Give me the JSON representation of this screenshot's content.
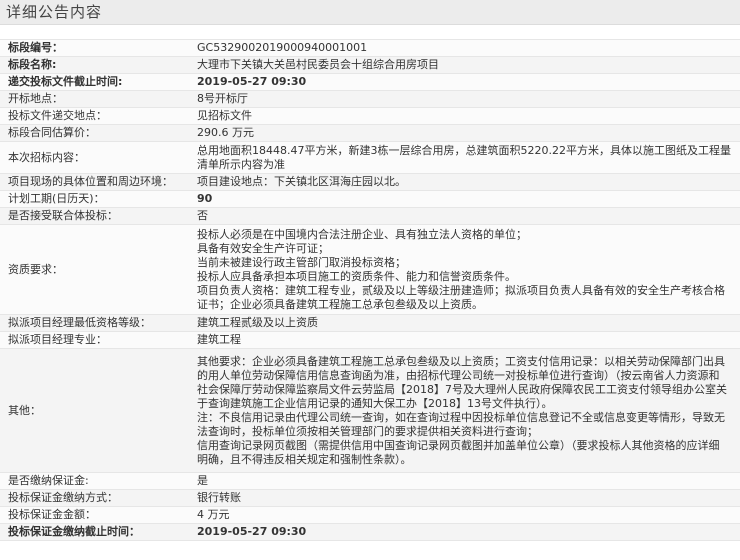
{
  "title": "详细公告内容",
  "rows": [
    {
      "label": "标段编号：",
      "value": "GC5329002019000940001001"
    },
    {
      "label": "标段名称:",
      "value": "大理市下关镇大关邑村民委员会十组综合用房项目"
    },
    {
      "label": "递交投标文件截止时间:",
      "value": "2019-05-27 09:30"
    },
    {
      "label": "开标地点：",
      "value": "8号开标厅"
    },
    {
      "label": "投标文件递交地点：",
      "value": "见招标文件"
    },
    {
      "label": "标段合同估算价：",
      "value": "290.6 万元"
    },
    {
      "label": "本次招标内容：",
      "lines": [
        "总用地面积18448.47平方米，新建3栋一层综合用房，总建筑面积5220.22平方米，具体以施工图纸及工程量",
        "清单所示内容为准"
      ]
    },
    {
      "label": "项目现场的具体位置和周边环境：",
      "value": "项目建设地点：下关镇北区洱海庄园以北。"
    },
    {
      "label": "计划工期(日历天)：",
      "value": "90"
    },
    {
      "label": "是否接受联合体投标：",
      "value": "否"
    },
    {
      "label": "资质要求：",
      "lines": [
        "投标人必须是在中国境内合法注册企业、具有独立法人资格的单位；",
        "具备有效安全生产许可证；",
        "当前未被建设行政主管部门取消投标资格；",
        "投标人应具备承担本项目施工的资质条件、能力和信誉资质条件。",
        "项目负责人资格：建筑工程专业，贰级及以上等级注册建造师；拟派项目负责人具备有效的安全生产考核合格",
        "证书；企业必须具备建筑工程施工总承包叁级及以上资质。"
      ]
    },
    {
      "label": "拟派项目经理最低资格等级：",
      "value": "建筑工程贰级及以上资质"
    },
    {
      "label": "拟派项目经理专业：",
      "value": "建筑工程"
    },
    {
      "label": "其他：",
      "lines": [
        "其他要求：企业必须具备建筑工程施工总承包叁级及以上资质；工资支付信用记录：以相关劳动保障部门出具",
        "的用人单位劳动保障信用信息查询函为准，由招标代理公司统一对投标单位进行查询）（按云南省人力资源和",
        "社会保障厅劳动保障监察局文件云劳监局【2018】7号及大理州人民政府保障农民工工资支付领导组办公室关",
        "于查询建筑施工企业信用记录的通知大保工办【2018】13号文件执行）。",
        "注：不良信用记录由代理公司统一查询，如在查询过程中因投标单位信息登记不全或信息变更等情形，导致无",
        "法查询时，投标单位须按相关管理部门的要求提供相关资料进行查询；",
        "信用查询记录网页截图（需提供信用中国查询记录网页截图并加盖单位公章）（要求投标人其他资格的应详细",
        "明确，且不得违反相关规定和强制性条款）。"
      ]
    },
    {
      "label": "是否缴纳保证金:",
      "value": "是"
    },
    {
      "label": "投标保证金缴纳方式：",
      "value": "银行转账"
    },
    {
      "label": "投标保证金金额：",
      "value": "4 万元"
    },
    {
      "label": "投标保证金缴纳截止时间：",
      "value": "2019-05-27 09:30"
    }
  ]
}
